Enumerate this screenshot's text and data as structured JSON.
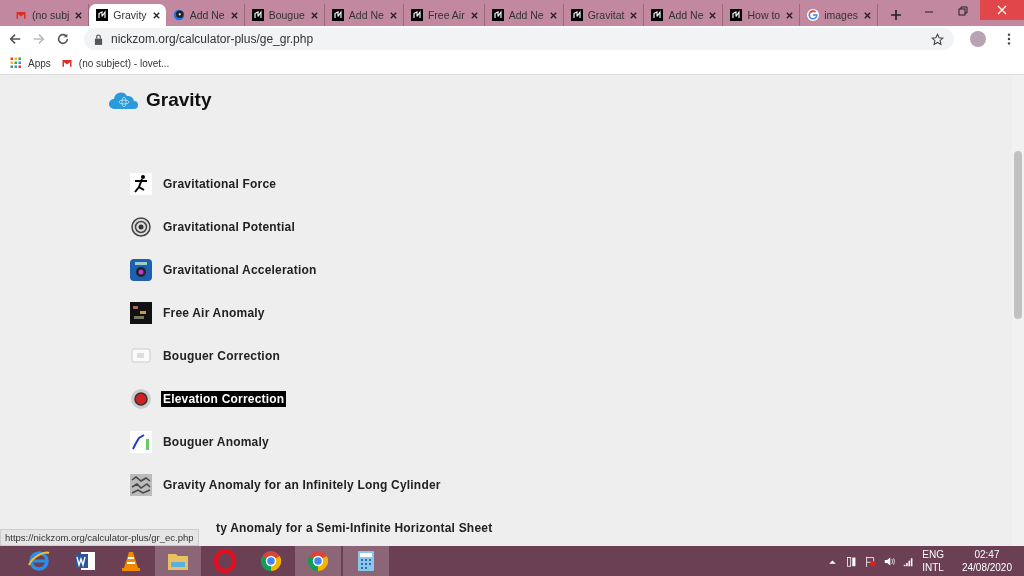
{
  "tabs": [
    {
      "label": "(no subj",
      "kind": "mail",
      "selected": false
    },
    {
      "label": "Gravity",
      "kind": "site",
      "selected": true
    },
    {
      "label": "Add Ne",
      "kind": "disc",
      "selected": false
    },
    {
      "label": "Bougue",
      "kind": "site",
      "selected": false
    },
    {
      "label": "Add Ne",
      "kind": "site",
      "selected": false
    },
    {
      "label": "Free Air",
      "kind": "site",
      "selected": false
    },
    {
      "label": "Add Ne",
      "kind": "site",
      "selected": false
    },
    {
      "label": "Gravitat",
      "kind": "site",
      "selected": false
    },
    {
      "label": "Add Ne",
      "kind": "site",
      "selected": false
    },
    {
      "label": "How to",
      "kind": "site",
      "selected": false
    },
    {
      "label": "images",
      "kind": "google",
      "selected": false
    }
  ],
  "address_bar": {
    "url": "nickzom.org/calculator-plus/ge_gr.php"
  },
  "bookmarks": [
    {
      "label": "Apps",
      "kind": "apps"
    },
    {
      "label": "(no subject) - lovet...",
      "kind": "mail"
    }
  ],
  "page": {
    "title": "Gravity",
    "items": [
      {
        "label": "Gravitational Force",
        "kind": "runner",
        "selected": false
      },
      {
        "label": "Gravitational Potential",
        "kind": "rings",
        "selected": false
      },
      {
        "label": "Gravitational Acceleration",
        "kind": "camera",
        "selected": false
      },
      {
        "label": "Free Air Anomaly",
        "kind": "grid",
        "selected": false
      },
      {
        "label": "Bouguer Correction",
        "kind": "screen",
        "selected": false
      },
      {
        "label": "Elevation Correction",
        "kind": "ball",
        "selected": true
      },
      {
        "label": "Bouguer Anomaly",
        "kind": "chart",
        "selected": false
      },
      {
        "label": "Gravity Anomaly for an Infinitely Long Cylinder",
        "kind": "noise",
        "selected": false
      },
      {
        "label": "ty Anomaly for a Semi-Infinite Horizontal Sheet",
        "kind": "covered",
        "selected": false
      }
    ]
  },
  "status_link": "https://nickzom.org/calculator-plus/gr_ec.php",
  "taskbar": {
    "apps": [
      {
        "kind": "ie",
        "running": false
      },
      {
        "kind": "word",
        "running": false
      },
      {
        "kind": "vlc",
        "running": false
      },
      {
        "kind": "folder",
        "running": true
      },
      {
        "kind": "opera",
        "running": false
      },
      {
        "kind": "chrome",
        "running": false
      },
      {
        "kind": "chrome",
        "running": true
      },
      {
        "kind": "calc",
        "running": true
      }
    ],
    "language": "ENG",
    "layout": "INTL",
    "time": "02:47",
    "date": "24/08/2020"
  }
}
